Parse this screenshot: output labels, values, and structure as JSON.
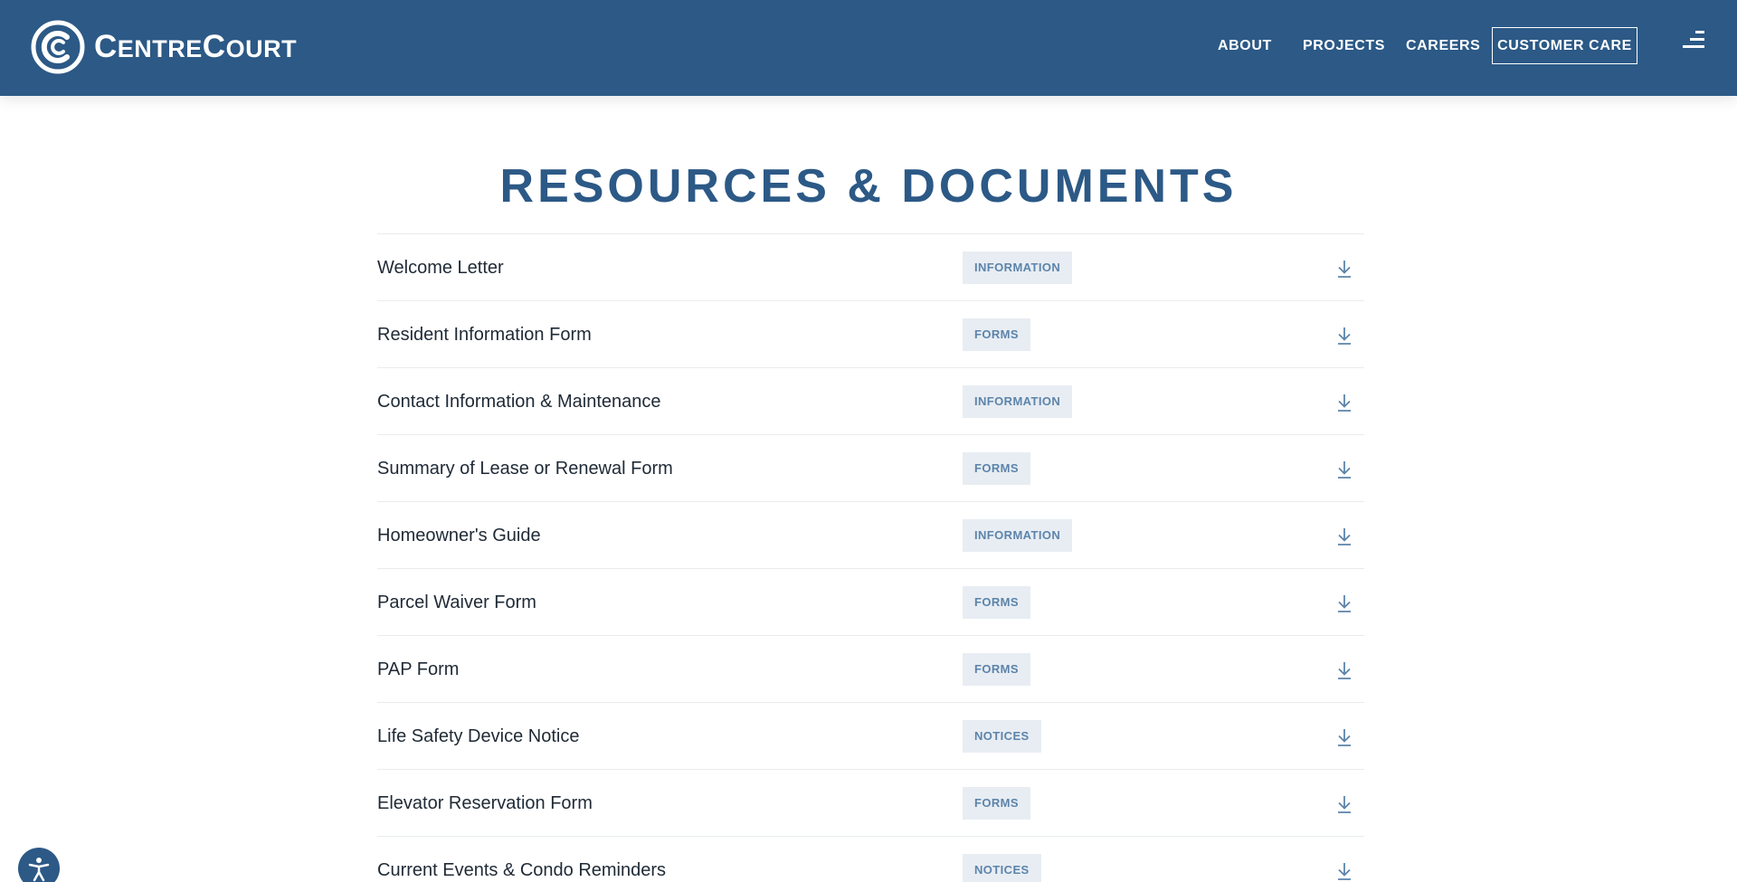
{
  "brand": {
    "name_first": "C",
    "name_rest_1": "ENTRE",
    "name_second": "C",
    "name_rest_2": "OURT"
  },
  "nav": {
    "about": "ABOUT",
    "projects": "PROJECTS",
    "careers": "CAREERS",
    "customer_care": "CUSTOMER CARE"
  },
  "icons": {
    "menu": "menu-icon",
    "download": "download-icon",
    "accessibility": "accessibility-icon",
    "logo": "centrecourt-logo"
  },
  "colors": {
    "primary": "#2c5986",
    "tag_bg": "#e8edf3",
    "tag_text": "#5c84ab"
  },
  "page": {
    "title": "RESOURCES & DOCUMENTS"
  },
  "documents": [
    {
      "name": "Welcome Letter",
      "tag": "INFORMATION"
    },
    {
      "name": "Resident Information Form",
      "tag": "FORMS"
    },
    {
      "name": "Contact Information & Maintenance",
      "tag": "INFORMATION"
    },
    {
      "name": "Summary of Lease or Renewal Form",
      "tag": "FORMS"
    },
    {
      "name": "Homeowner's Guide",
      "tag": "INFORMATION"
    },
    {
      "name": "Parcel Waiver Form",
      "tag": "FORMS"
    },
    {
      "name": "PAP Form",
      "tag": "FORMS"
    },
    {
      "name": "Life Safety Device Notice",
      "tag": "NOTICES"
    },
    {
      "name": "Elevator Reservation Form",
      "tag": "FORMS"
    },
    {
      "name": "Current Events & Condo Reminders",
      "tag": "NOTICES"
    }
  ]
}
